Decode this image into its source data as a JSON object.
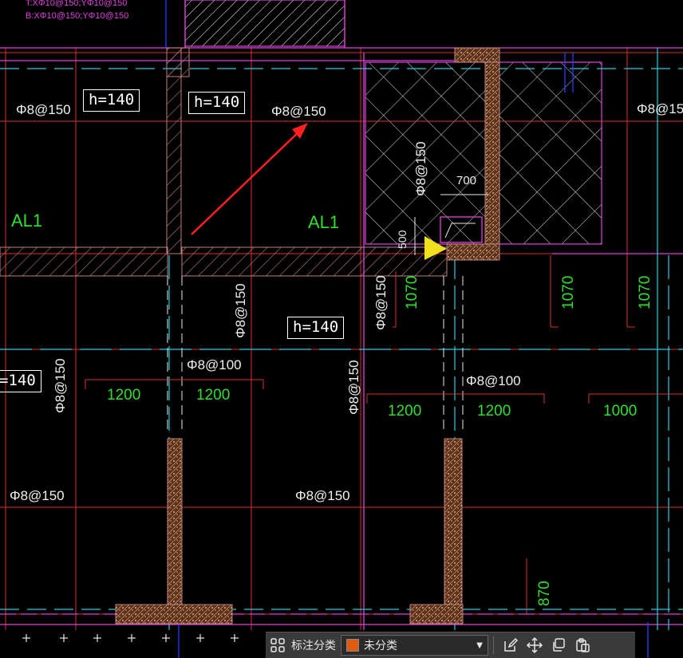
{
  "drawing": {
    "header_note_1": "T:XΦ10@150;YΦ10@150",
    "header_note_2": "B:XΦ10@150;YΦ10@150",
    "slab_thickness": [
      "h=140",
      "h=140",
      "h=140",
      "=140"
    ],
    "rebar_150": "Φ8@150",
    "rebar_100": "Φ8@100",
    "beam_label": "AL1",
    "dims": [
      "1200",
      "1200",
      "1200",
      "1200",
      "1000",
      "1070",
      "1070",
      "1070",
      "870",
      "700",
      "500"
    ]
  },
  "toolbar": {
    "category_label": "标注分类",
    "category_value": "未分类",
    "category_color": "#e05a10",
    "icons": [
      "grid-apps-icon",
      "edit-icon",
      "move-icon",
      "copy-icon",
      "paste-icon"
    ]
  },
  "colors": {
    "background": "#000000",
    "magenta": "#e040e0",
    "red": "#d83030",
    "cyan": "#20d0e0",
    "green": "#2ee02e",
    "blue": "#2040ff",
    "hatch": "#c08080",
    "yellow": "#f0e020"
  }
}
